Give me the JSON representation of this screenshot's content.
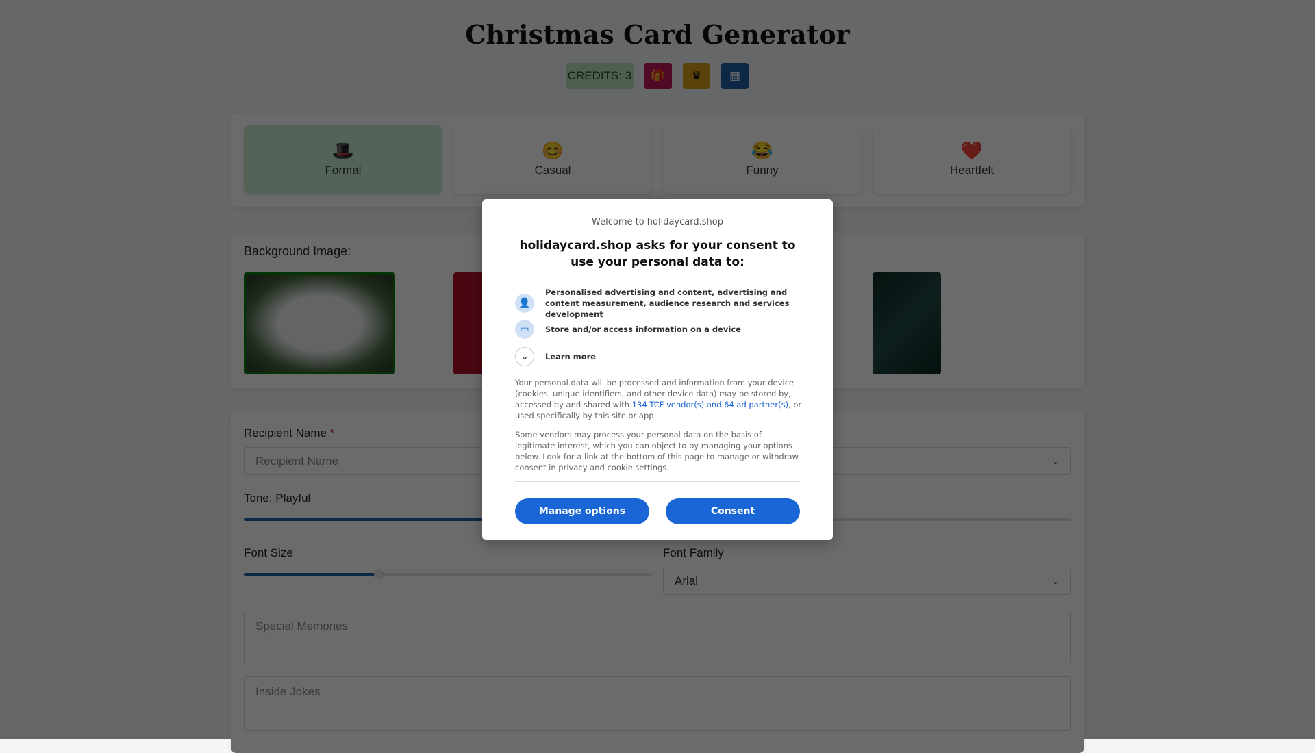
{
  "header": {
    "title": "Christmas Card Generator",
    "credits": "CREDITS: 3",
    "icons": [
      "gift-icon",
      "crown-icon",
      "calendar-icon"
    ],
    "colors": {
      "credits_bg": "#b5e3c0",
      "gift": "#c2185b",
      "crown": "#d4a017",
      "calendar": "#1e5fa8"
    }
  },
  "tones": [
    {
      "emoji": "🎩",
      "label": "Formal",
      "selected": true
    },
    {
      "emoji": "😊",
      "label": "Casual"
    },
    {
      "emoji": "😂",
      "label": "Funny"
    },
    {
      "emoji": "❤️",
      "label": "Heartfelt"
    }
  ],
  "background": {
    "label": "Background Image:"
  },
  "form": {
    "recipient_label": "Recipient Name",
    "required_mark": "*",
    "recipient_placeholder": "Recipient Name",
    "tone_label": "Tone: Playful",
    "font_size_label": "Font Size",
    "font_size_fraction": 0.33,
    "font_family_label": "Font Family",
    "font_family_value": "Arial",
    "memories_placeholder": "Special Memories",
    "jokes_placeholder": "Inside Jokes"
  },
  "consent": {
    "welcome": "Welcome to holidaycard.shop",
    "title": "holidaycard.shop asks for your consent to use your personal data to:",
    "purposes": [
      {
        "icon": "person-icon",
        "text": "Personalised advertising and content, advertising and content measurement, audience research and services development"
      },
      {
        "icon": "devices-icon",
        "text": "Store and/or access information on a device"
      }
    ],
    "learn_more": "Learn more",
    "para1_a": "Your personal data will be processed and information from your device (cookies, unique identifiers, and other device data) may be stored by, accessed by and shared with ",
    "para1_link": "134 TCF vendor(s) and 64 ad partner(s)",
    "para1_b": ", or used specifically by this site or app.",
    "para2": "Some vendors may process your personal data on the basis of legitimate interest, which you can object to by managing your options below. Look for a link at the bottom of this page to manage or withdraw consent in privacy and cookie settings.",
    "manage": "Manage options",
    "consent": "Consent",
    "accent": "#1a66d6"
  }
}
